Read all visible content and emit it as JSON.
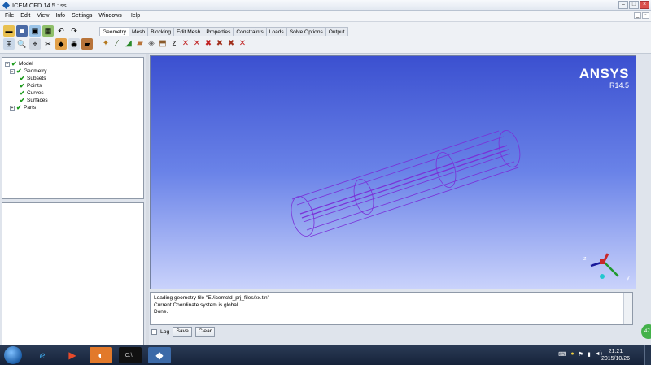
{
  "window": {
    "title": "ICEM CFD 14.5 : ss"
  },
  "menu": [
    "File",
    "Edit",
    "View",
    "Info",
    "Settings",
    "Windows",
    "Help"
  ],
  "tabs": [
    "Geometry",
    "Mesh",
    "Blocking",
    "Edit Mesh",
    "Properties",
    "Constraints",
    "Loads",
    "Solve Options",
    "Output"
  ],
  "active_tab": "Geometry",
  "tree": {
    "root": "Model",
    "geometry": "Geometry",
    "subsets": "Subsets",
    "points": "Points",
    "curves": "Curves",
    "surfaces": "Surfaces",
    "parts": "Parts"
  },
  "viewport": {
    "logo": "ANSYS",
    "version": "R14.5",
    "axes": {
      "x": "x",
      "y": "y",
      "z": "z"
    },
    "background_top": "#3b50d0",
    "background_bottom": "#c9d2fb",
    "geometry_color": "#7a2fd8"
  },
  "messages": {
    "lines": [
      "Loading geometry file \"E:/icemcfd_prj_files/xx.tin\"",
      "Current Coordinate system is global",
      "Done."
    ],
    "log_label": "Log",
    "save_label": "Save",
    "clear_label": "Clear"
  },
  "badge": "47",
  "taskbar": {
    "time": "21:21",
    "date": "2015/10/26"
  },
  "icons": {
    "toolbar_utility": [
      "open-folder-icon",
      "save-icon",
      "image-icon",
      "settings-grid-icon",
      "undo-icon",
      "redo-icon",
      "spare",
      "fit-icon",
      "zoom-icon",
      "measure-icon",
      "scissors-icon",
      "color-icon",
      "sphere-icon",
      "brick-icon"
    ],
    "geometry_row": [
      "create-point-icon",
      "create-curve-icon",
      "create-surface-icon",
      "create-body-icon",
      "repair-icon",
      "transform-icon",
      "restore-icon",
      "delete-point-icon",
      "delete-curve-icon",
      "delete-surface-icon",
      "delete-body-icon",
      "delete-any-icon",
      "delete-x-icon"
    ]
  }
}
